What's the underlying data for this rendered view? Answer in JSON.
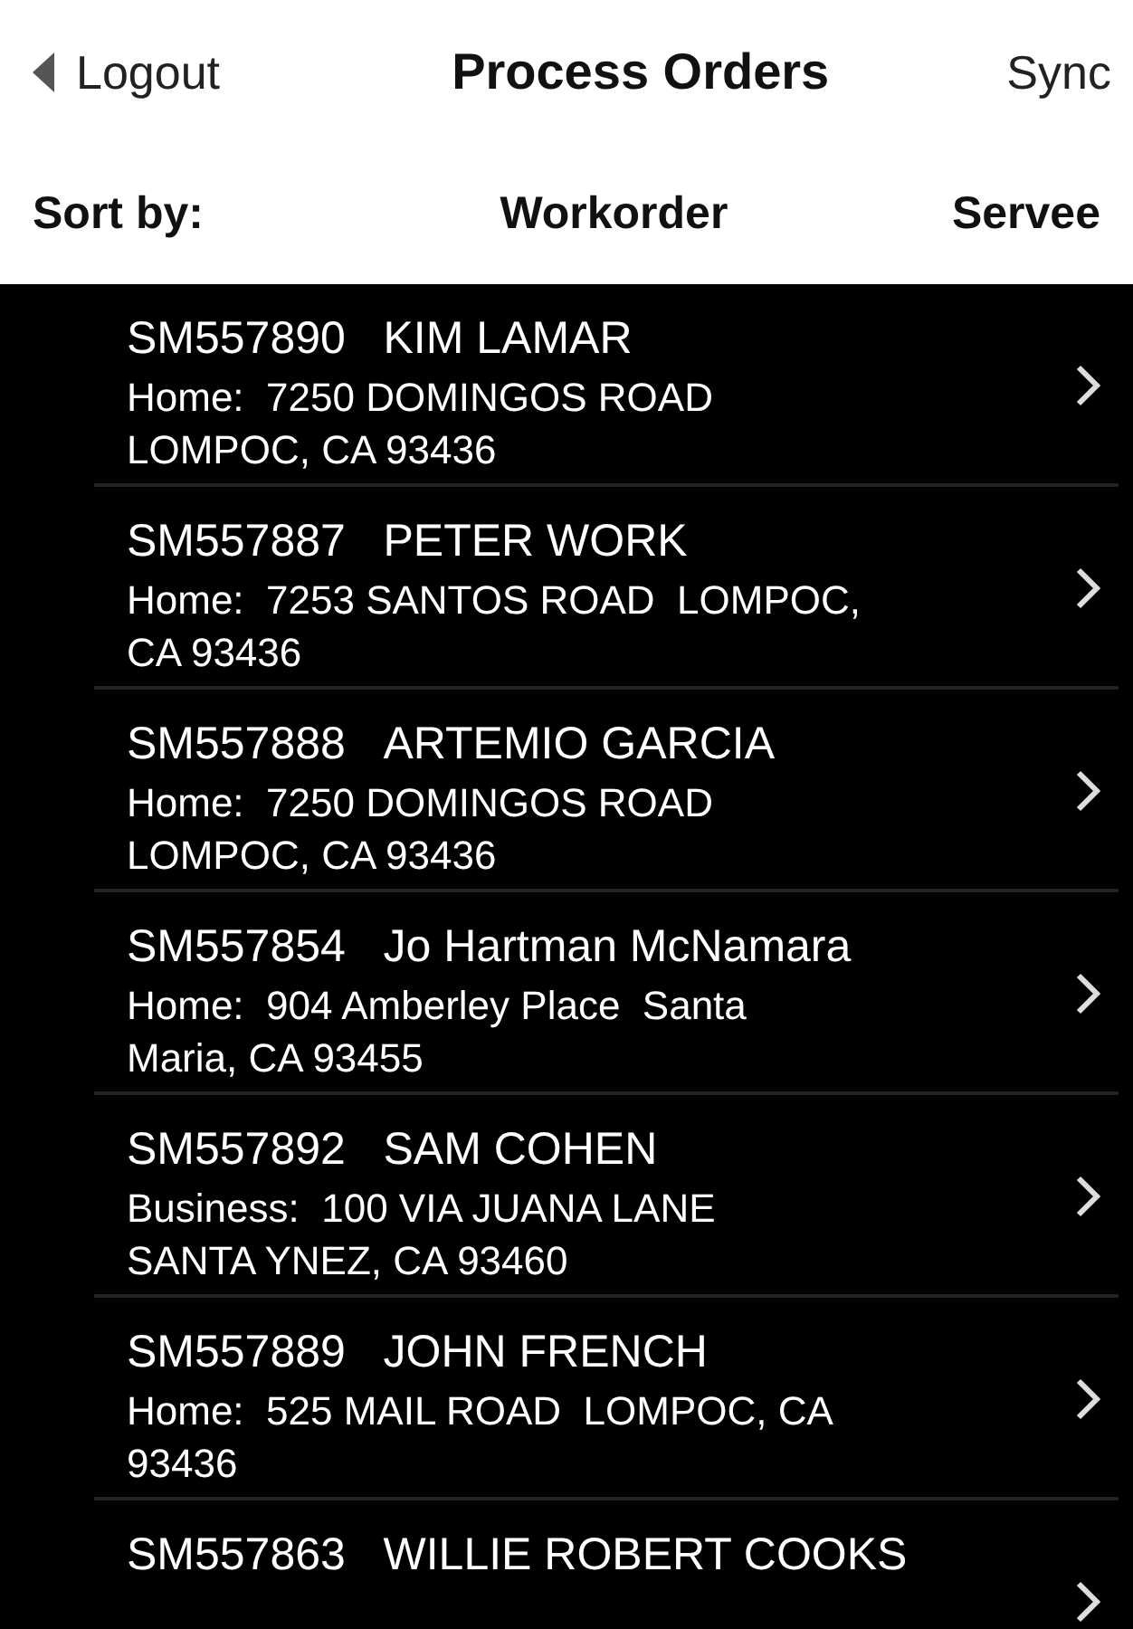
{
  "header": {
    "back": "Logout",
    "title": "Process Orders",
    "action": "Sync"
  },
  "sort_bar": {
    "label": "Sort by:",
    "options": [
      "Workorder",
      "Servee"
    ]
  },
  "orders": [
    {
      "workorder": "SM557890",
      "servee": "KIM LAMAR",
      "address": [
        "Home:  7250 DOMINGOS ROAD",
        "LOMPOC, CA 93436"
      ]
    },
    {
      "workorder": "SM557887",
      "servee": "PETER WORK",
      "address": [
        "Home:  7253 SANTOS ROAD  LOMPOC,",
        "CA 93436"
      ]
    },
    {
      "workorder": "SM557888",
      "servee": "ARTEMIO GARCIA",
      "address": [
        "Home:  7250 DOMINGOS ROAD",
        "LOMPOC, CA 93436"
      ]
    },
    {
      "workorder": "SM557854",
      "servee": "Jo Hartman McNamara",
      "address": [
        "Home:  904 Amberley Place  Santa",
        "Maria, CA 93455"
      ]
    },
    {
      "workorder": "SM557892",
      "servee": "SAM COHEN",
      "address": [
        "Business:  100 VIA JUANA LANE",
        "SANTA YNEZ, CA 93460"
      ]
    },
    {
      "workorder": "SM557889",
      "servee": "JOHN FRENCH",
      "address": [
        "Home:  525 MAIL ROAD  LOMPOC, CA",
        "93436"
      ]
    },
    {
      "workorder": "SM557863",
      "servee": "WILLIE ROBERT COOKS"
    }
  ]
}
